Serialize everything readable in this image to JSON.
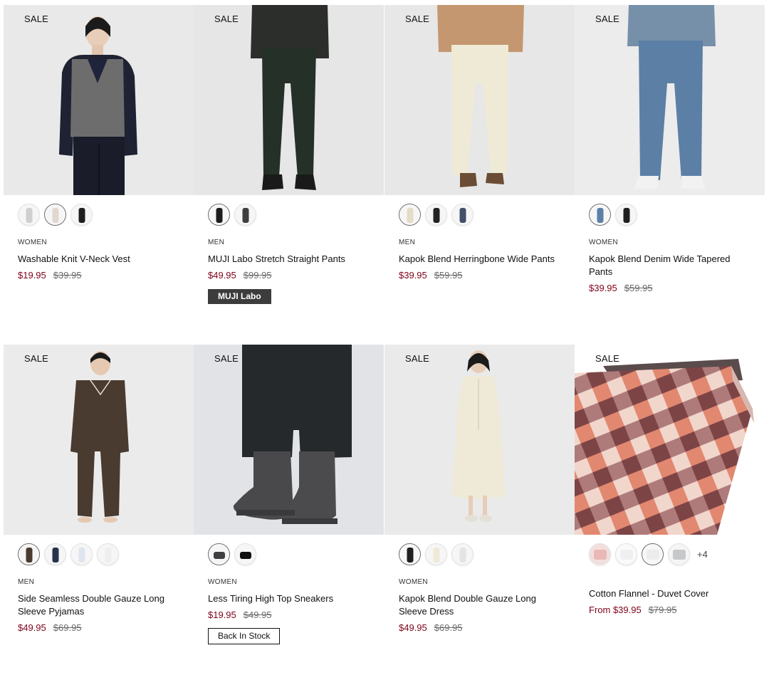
{
  "products": [
    {
      "badge": "SALE",
      "category": "WOMEN",
      "title": "Washable Knit V-Neck Vest",
      "price": "$19.95",
      "original_price": "$39.95",
      "swatches": [
        "light-grey",
        "beige",
        "black"
      ],
      "selected_swatch": 1
    },
    {
      "badge": "SALE",
      "category": "MEN",
      "title": "MUJI Labo Stretch Straight Pants",
      "price": "$49.95",
      "original_price": "$99.95",
      "tag": "MUJI Labo",
      "swatches": [
        "black",
        "dark-grey"
      ],
      "selected_swatch": 0
    },
    {
      "badge": "SALE",
      "category": "MEN",
      "title": "Kapok Blend Herringbone Wide Pants",
      "price": "$39.95",
      "original_price": "$59.95",
      "swatches": [
        "ecru",
        "black",
        "navy"
      ],
      "selected_swatch": 0
    },
    {
      "badge": "SALE",
      "category": "WOMEN",
      "title": "Kapok Blend Denim Wide Tapered Pants",
      "price": "$39.95",
      "original_price": "$59.95",
      "swatches": [
        "blue",
        "black"
      ],
      "selected_swatch": 0
    },
    {
      "badge": "SALE",
      "category": "MEN",
      "title": "Side Seamless Double Gauze Long Sleeve Pyjamas",
      "price": "$49.95",
      "original_price": "$69.95",
      "swatches": [
        "brown",
        "navy",
        "light-blue",
        "white"
      ],
      "selected_swatch": 0
    },
    {
      "badge": "SALE",
      "category": "WOMEN",
      "title": "Less Tiring High Top Sneakers",
      "price": "$19.95",
      "original_price": "$49.95",
      "tag": "Back In Stock",
      "swatches": [
        "dark-grey",
        "black"
      ],
      "selected_swatch": 0
    },
    {
      "badge": "SALE",
      "category": "WOMEN",
      "title": "Kapok Blend Double Gauze Long Sleeve Dress",
      "price": "$49.95",
      "original_price": "$69.95",
      "swatches": [
        "black",
        "ecru",
        "light-grey"
      ],
      "selected_swatch": 0
    },
    {
      "badge": "SALE",
      "category": "",
      "title": "Cotton Flannel - Duvet Cover",
      "price": "From $39.95",
      "original_price": "$79.95",
      "swatches": [
        "pink-check",
        "white",
        "light-grey",
        "grey"
      ],
      "selected_swatch": 2,
      "more_swatches": "+4"
    }
  ],
  "colors": {
    "sale_price": "#7f0019",
    "original_price": "#6b6b6b",
    "muji_labo_tag_bg": "#3c3c3c"
  }
}
